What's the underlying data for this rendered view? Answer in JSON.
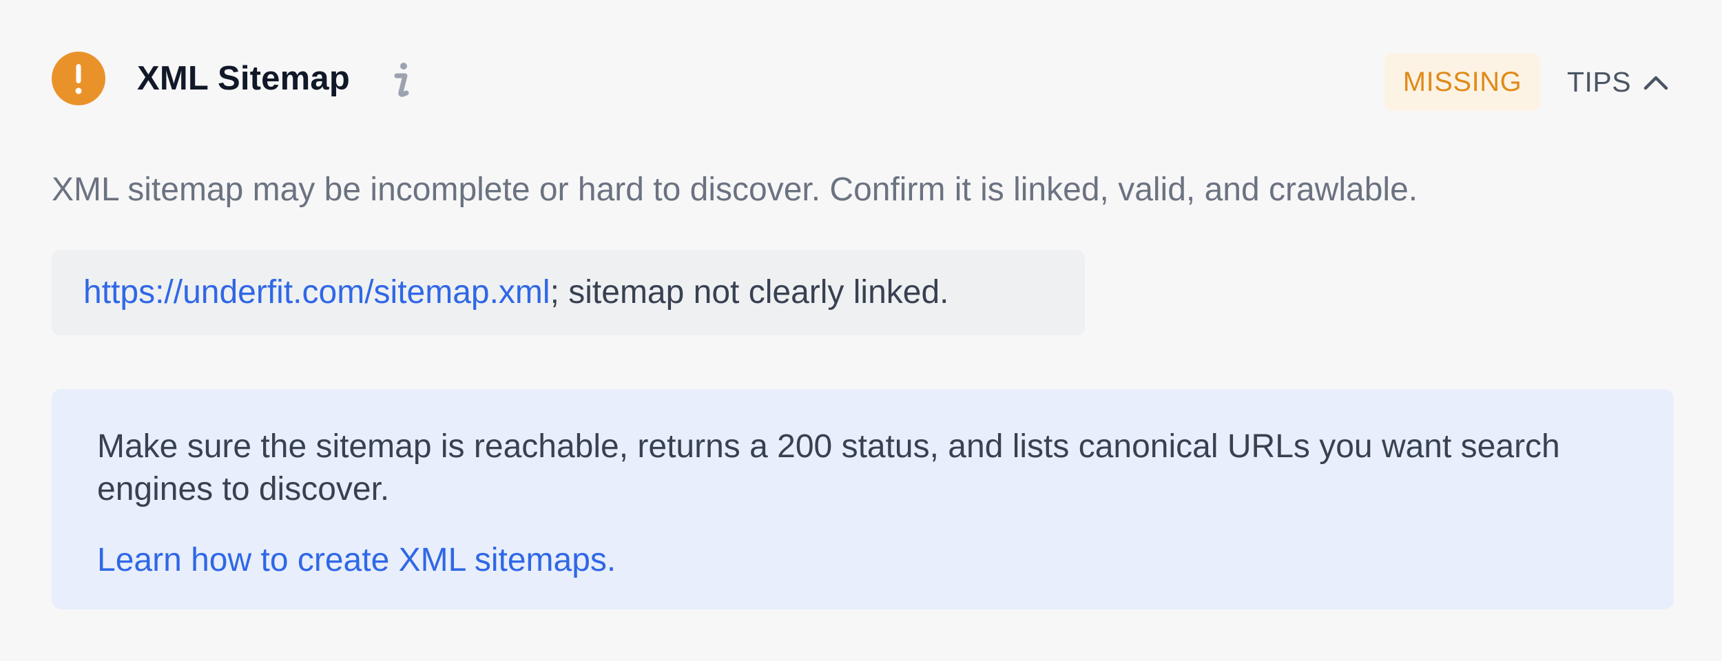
{
  "header": {
    "title": "XML Sitemap",
    "status_label": "MISSING",
    "tips_label": "TIPS",
    "icons": {
      "status": "warning-exclamation-icon",
      "info": "info-icon",
      "toggle": "chevron-up-icon"
    }
  },
  "description": "XML sitemap may be incomplete or hard to discover. Confirm it is linked, valid, and crawlable.",
  "evidence": {
    "link_text": "https://underfit.com/sitemap.xml",
    "suffix": "; sitemap not clearly linked."
  },
  "tip": {
    "text": "Make sure the sitemap is reachable, returns a 200 status, and lists canonical URLs you want search engines to discover.",
    "link_label": "Learn how to create XML sitemaps."
  },
  "colors": {
    "warning": "#ea922a",
    "badge_bg": "#fdf3e4",
    "badge_text": "#e08a1a",
    "link": "#2f67e6",
    "tip_bg": "#e8eefb",
    "evidence_bg": "#eff0f2"
  }
}
